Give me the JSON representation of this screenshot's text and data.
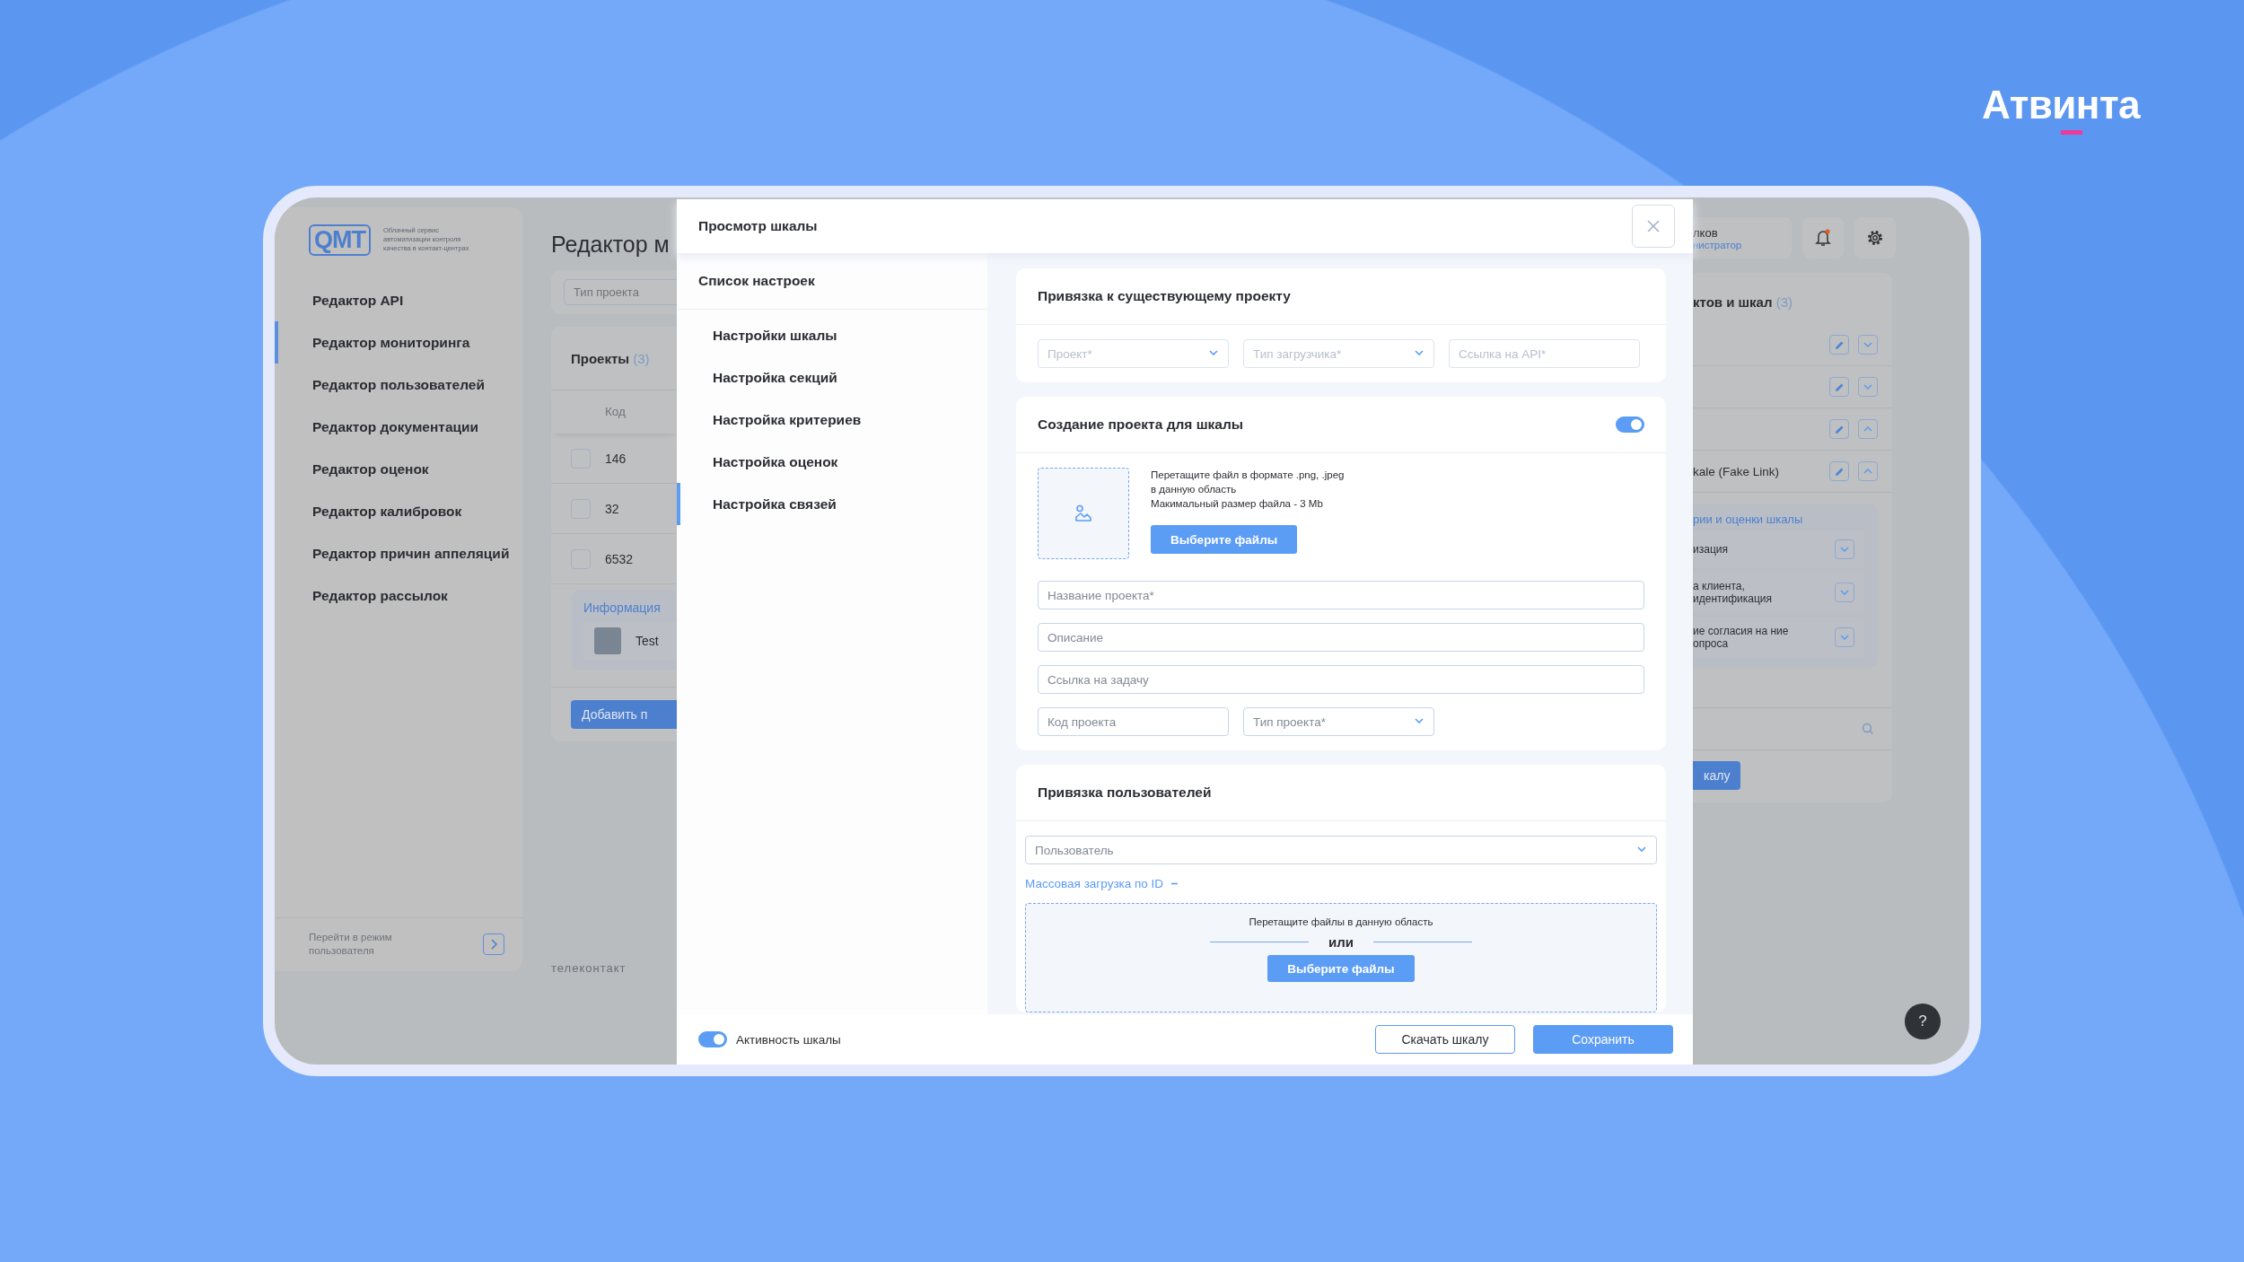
{
  "brand": {
    "name": "Атвинта"
  },
  "background_app": {
    "logo": "QMT",
    "tagline": "Облачный сервис автоматизации контроля качества в контакт-центрах",
    "nav": [
      {
        "label": "Редактор API",
        "selected": false
      },
      {
        "label": "Редактор мониторинга",
        "selected": true
      },
      {
        "label": "Редактор пользователей",
        "selected": false
      },
      {
        "label": "Редактор документации",
        "selected": false
      },
      {
        "label": "Редактор оценок",
        "selected": false
      },
      {
        "label": "Редактор калибровок",
        "selected": false
      },
      {
        "label": "Редактор причин аппеляций",
        "selected": false
      },
      {
        "label": "Редактор рассылок",
        "selected": false
      }
    ],
    "switch_mode": "Перейти в режим пользователя",
    "page_title": "Редактор м",
    "filter_placeholder": "Тип проекта",
    "projects": {
      "title": "Проекты",
      "count": "(3)",
      "column": "Код",
      "rows": [
        {
          "code": "146",
          "checked": false
        },
        {
          "code": "32",
          "checked": false
        },
        {
          "code": "6532",
          "checked": false
        }
      ],
      "info_title": "Информация",
      "info_item": "Test",
      "add_button": "Добавить п"
    },
    "footer_logo": "телеконтакт",
    "user": {
      "name": "лков",
      "role": "нистратор"
    },
    "has_notification": true,
    "scales": {
      "title": "ктов и шкал",
      "count": "(3)",
      "rows": [
        {
          "expanded": false
        },
        {
          "expanded": false
        },
        {
          "expanded": true
        },
        {
          "label": "kale (Fake Link)",
          "expanded": true
        }
      ],
      "group_title": "рии и оценки шкалы",
      "items": [
        {
          "label": "изация",
          "expanded": false
        },
        {
          "label": "а клиента, идентификация",
          "expanded": false
        },
        {
          "label": "ие согласия на ние опроса",
          "expanded": false
        }
      ],
      "add_button": "калу"
    },
    "help": "?"
  },
  "modal": {
    "title": "Просмотр шкалы",
    "settings_title": "Список настроек",
    "settings": [
      {
        "label": "Настройки шкалы",
        "selected": false
      },
      {
        "label": "Настройка секций",
        "selected": false
      },
      {
        "label": "Настройка критериев",
        "selected": false
      },
      {
        "label": "Настройка оценок",
        "selected": false
      },
      {
        "label": "Настройка связей",
        "selected": true
      }
    ],
    "existing_project": {
      "title": "Привязка к существующему проекту",
      "fields": [
        {
          "placeholder": "Проект*",
          "kind": "select",
          "disabled": true
        },
        {
          "placeholder": "Тип загрузчика*",
          "kind": "select",
          "disabled": true
        },
        {
          "placeholder": "Ссылка на API*",
          "kind": "input",
          "disabled": true
        }
      ]
    },
    "new_project": {
      "title": "Создание проекта для шкалы",
      "on": true,
      "upload_hint": [
        "Перетащите файл в формате .png, .jpeg",
        "в данную область",
        "Макимальный размер файла - 3 Mb"
      ],
      "upload_button": "Выберите файлы",
      "fields": [
        {
          "placeholder": "Название проекта*",
          "kind": "input",
          "disabled": false
        },
        {
          "placeholder": "Описание",
          "kind": "input",
          "disabled": false
        },
        {
          "placeholder": "Ссылка на задачу",
          "kind": "input",
          "disabled": false
        }
      ],
      "short_fields": [
        {
          "placeholder": "Код проекта",
          "kind": "input",
          "disabled": false
        },
        {
          "placeholder": "Тип проекта*",
          "kind": "select",
          "disabled": false
        }
      ]
    },
    "users": {
      "title": "Привязка пользователей",
      "user_placeholder": "Пользователь",
      "bulk_link": "Массовая загрузка по ID",
      "bulk_expanded": true,
      "drop_hint": "Перетащите файлы в данную область",
      "or": "или",
      "drop_button": "Выберите файлы"
    },
    "active_label": "Активность шкалы",
    "active_on": true,
    "buttons": [
      {
        "label": "Скачать шкалу",
        "kind": "secondary"
      },
      {
        "label": "Сохранить",
        "kind": "primary"
      }
    ]
  }
}
